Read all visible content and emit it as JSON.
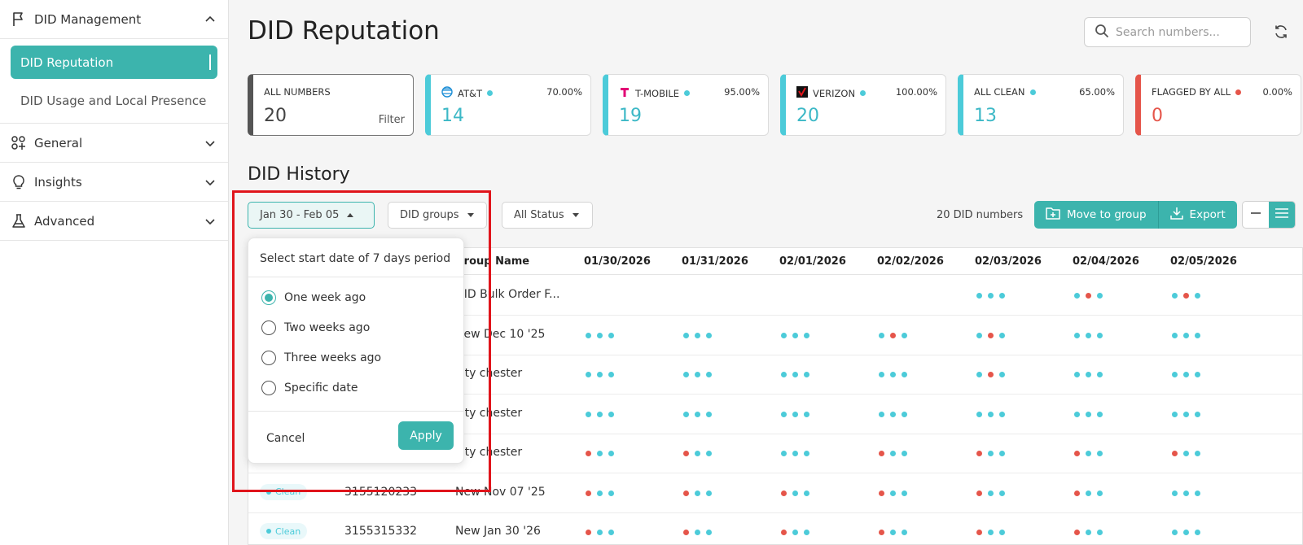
{
  "sidebar": {
    "did_management": "DID Management",
    "items": [
      "DID Reputation",
      "DID Usage and Local Presence"
    ],
    "general": "General",
    "insights": "Insights",
    "advanced": "Advanced"
  },
  "header": {
    "title": "DID Reputation",
    "search_placeholder": "Search numbers..."
  },
  "cards": [
    {
      "label": "ALL NUMBERS",
      "value": "20",
      "filter": "Filter"
    },
    {
      "label": "AT&T",
      "pct": "70.00%",
      "value": "14"
    },
    {
      "label": "T-MOBILE",
      "pct": "95.00%",
      "value": "19"
    },
    {
      "label": "VERIZON",
      "pct": "100.00%",
      "value": "20"
    },
    {
      "label": "ALL CLEAN",
      "pct": "65.00%",
      "value": "13"
    },
    {
      "label": "FLAGGED BY ALL",
      "pct": "0.00%",
      "value": "0"
    }
  ],
  "history": {
    "title": "DID History",
    "date_range": "Jan 30 - Feb 05",
    "groups": "DID groups",
    "status": "All Status",
    "count": "20 DID numbers",
    "move": "Move to group",
    "export": "Export"
  },
  "table": {
    "headers": [
      "Group Name",
      "01/30/2026",
      "01/31/2026",
      "02/01/2026",
      "02/02/2026",
      "02/03/2026",
      "02/04/2026",
      "02/05/2026"
    ],
    "rows": [
      {
        "group": "DID Bulk Order F...",
        "dots": [
          null,
          null,
          null,
          null,
          "bbb",
          "brb",
          "brb"
        ]
      },
      {
        "group": "New Dec 10 '25",
        "dots": [
          "bbb",
          "bbb",
          "bbb",
          "brb",
          "brb",
          "bbb",
          "bbb"
        ]
      },
      {
        "group": "city chester",
        "dots": [
          "bbb",
          "bbb",
          "bbb",
          "bbb",
          "brb",
          "bbb",
          "bbb"
        ]
      },
      {
        "group": "city chester",
        "dots": [
          "bbb",
          "bbb",
          "bbb",
          "bbb",
          "bbb",
          "bbb",
          "bbb"
        ]
      },
      {
        "group": "city chester",
        "dots": [
          "rbb",
          "rbb",
          "bbb",
          "rbb",
          "rbb",
          "rbb",
          "rbb"
        ]
      },
      {
        "status": "Clean",
        "number": "3155120233",
        "group": "New Nov 07 '25",
        "dots": [
          "rbb",
          "rbb",
          "rbb",
          "rbb",
          "rbb",
          "rbb",
          "bbb"
        ]
      },
      {
        "status": "Clean",
        "number": "3155315332",
        "group": "New Jan 30 '26",
        "dots": [
          "rbb",
          "rbb",
          "rbb",
          "rbb",
          "rbb",
          "rbb",
          "bbb"
        ]
      }
    ]
  },
  "popup": {
    "title": "Select start date of 7 days period",
    "options": [
      "One week ago",
      "Two weeks ago",
      "Three weeks ago",
      "Specific date"
    ],
    "cancel": "Cancel",
    "apply": "Apply"
  }
}
